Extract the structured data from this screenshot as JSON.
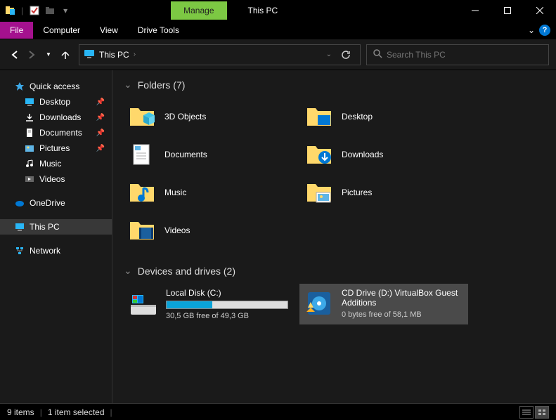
{
  "titlebar": {
    "manage_tab": "Manage",
    "title": "This PC"
  },
  "ribbon": {
    "file": "File",
    "computer": "Computer",
    "view": "View",
    "drive_tools": "Drive Tools"
  },
  "nav": {
    "address_location": "This PC",
    "search_placeholder": "Search This PC"
  },
  "sidebar": {
    "quick_access": "Quick access",
    "desktop": "Desktop",
    "downloads": "Downloads",
    "documents": "Documents",
    "pictures": "Pictures",
    "music": "Music",
    "videos": "Videos",
    "onedrive": "OneDrive",
    "this_pc": "This PC",
    "network": "Network"
  },
  "content": {
    "folders_header": "Folders (7)",
    "drives_header": "Devices and drives (2)",
    "folders": {
      "objects_3d": "3D Objects",
      "desktop": "Desktop",
      "documents": "Documents",
      "downloads": "Downloads",
      "music": "Music",
      "pictures": "Pictures",
      "videos": "Videos"
    },
    "drives": {
      "local": {
        "name": "Local Disk (C:)",
        "free": "30,5 GB free of 49,3 GB",
        "fill_percent": 38
      },
      "cd": {
        "name": "CD Drive (D:) VirtualBox Guest Additions",
        "free": "0 bytes free of 58,1 MB"
      }
    }
  },
  "statusbar": {
    "items": "9 items",
    "selected": "1 item selected"
  }
}
